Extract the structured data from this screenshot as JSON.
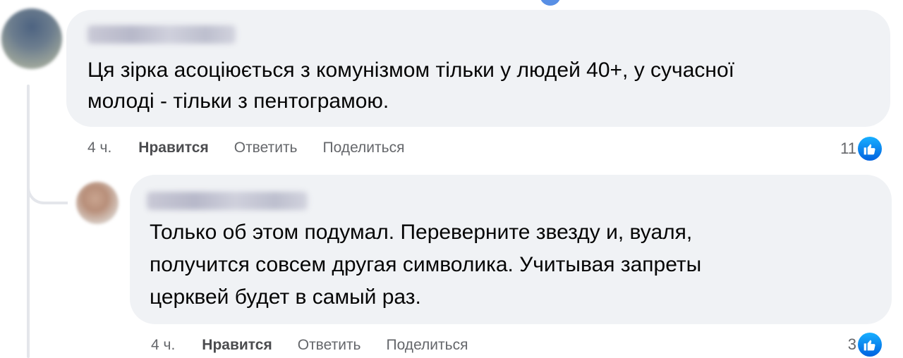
{
  "comments": [
    {
      "text_lines": [
        "Ця зірка асоціюється з комунізмом тільки у людей 40+, у сучасної",
        "молоді - тільки з пентограмою."
      ],
      "time": "4 ч.",
      "like_label": "Нравится",
      "reply_label": "Ответить",
      "share_label": "Поделиться",
      "reaction_count": "11",
      "reaction_icon": "thumbs-up-icon"
    },
    {
      "text_lines": [
        "Только об этом подумал. Переверните звезду и, вуаля,",
        "получится совсем другая символика. Учитывая запреты",
        "церквей будет в самый раз."
      ],
      "time": "4 ч.",
      "like_label": "Нравится",
      "reply_label": "Ответить",
      "share_label": "Поделиться",
      "reaction_count": "3",
      "reaction_icon": "thumbs-up-icon"
    }
  ],
  "colors": {
    "bubble": "#f0f2f5",
    "action_text": "#65676b",
    "like_blue": "#0062e0"
  }
}
